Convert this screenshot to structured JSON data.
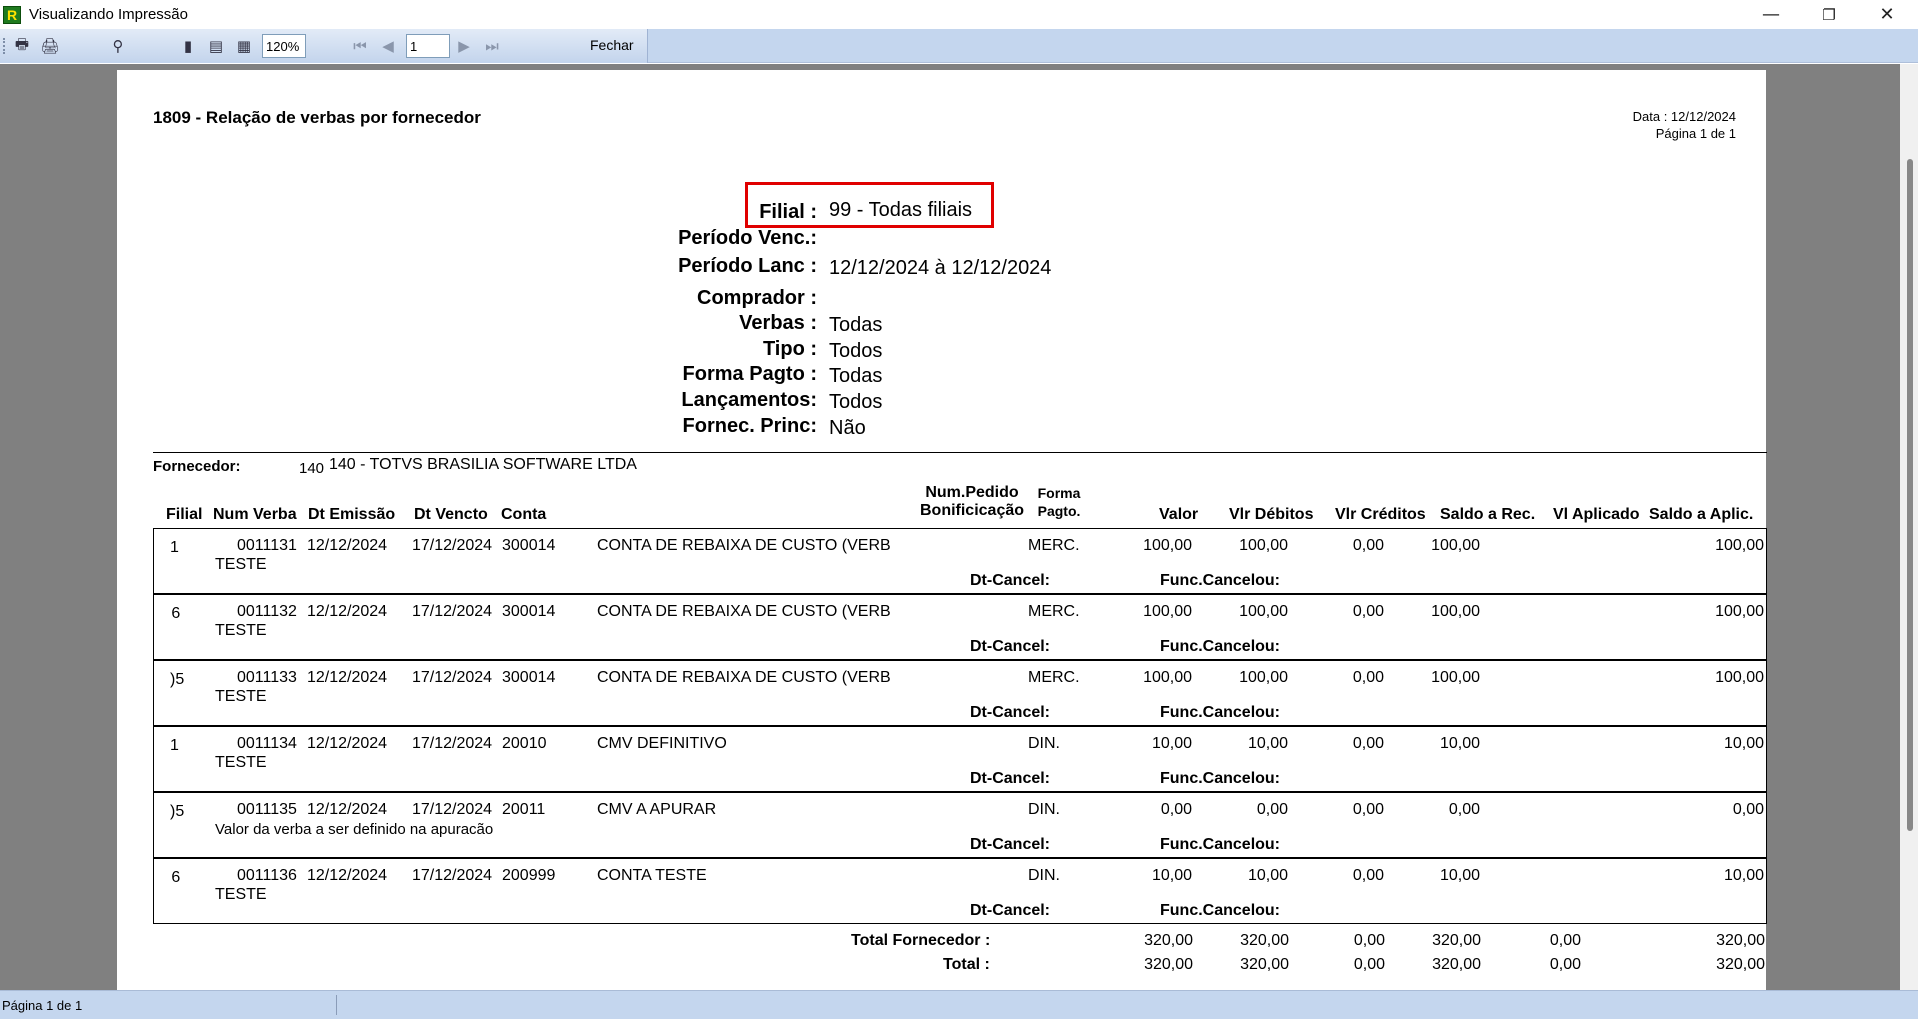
{
  "window": {
    "title": "Visualizando Impressão",
    "app_icon_letter": "R",
    "minimize": "—",
    "restore": "❐",
    "close": "✕"
  },
  "toolbar": {
    "zoom": "120%",
    "page_number": "1",
    "close_label": "Fechar"
  },
  "report": {
    "title": "1809 - Relação de verbas por fornecedor",
    "date": "Data : 12/12/2024",
    "page": "Página 1 de 1"
  },
  "params": [
    {
      "label": "Filial :",
      "value": "99 - Todas filiais"
    },
    {
      "label": "Período Venc.:",
      "value": ""
    },
    {
      "label": "Período Lanc :",
      "value": "12/12/2024 à 12/12/2024"
    },
    {
      "label": "Comprador :",
      "value": ""
    },
    {
      "label": "Verbas :",
      "value": "Todas"
    },
    {
      "label": "Tipo :",
      "value": "Todos"
    },
    {
      "label": "Forma Pagto :",
      "value": "Todas"
    },
    {
      "label": "Lançamentos:",
      "value": "Todos"
    },
    {
      "label": "Fornec. Princ:",
      "value": "Não"
    }
  ],
  "supplier": {
    "label": "Fornecedor:",
    "code": "140",
    "name": "140 - TOTVS BRASILIA SOFTWARE LTDA"
  },
  "columns": {
    "filial": "Filial",
    "num_verba": "Num Verba",
    "dt_emissao": "Dt Emissão",
    "dt_vencto": "Dt Vencto",
    "conta": "Conta",
    "num_pedido_1": "Num.Pedido",
    "num_pedido_2": "Bonificicação",
    "forma_1": "Forma",
    "forma_2": "Pagto.",
    "valor": "Valor",
    "vlr_debitos": "Vlr Débitos",
    "vlr_creditos": "Vlr Créditos",
    "saldo_rec": "Saldo a Rec.",
    "vl_aplicado": "Vl Aplicado",
    "saldo_aplic": "Saldo a Aplic."
  },
  "row_labels": {
    "dt_cancel": "Dt-Cancel:",
    "func_cancelou": "Func.Cancelou:"
  },
  "rows": [
    {
      "filial": "1",
      "num_verba": "0011131",
      "dt_emissao": "12/12/2024",
      "dt_vencto": "17/12/2024",
      "conta": "300014",
      "descricao": "CONTA DE REBAIXA DE CUSTO (VERB",
      "forma": "MERC.",
      "valor": "100,00",
      "debitos": "100,00",
      "creditos": "0,00",
      "saldo_rec": "100,00",
      "vl_aplicado": "",
      "saldo_aplic": "100,00",
      "obs": "TESTE"
    },
    {
      "filial": " 6",
      "num_verba": "0011132",
      "dt_emissao": "12/12/2024",
      "dt_vencto": "17/12/2024",
      "conta": "300014",
      "descricao": "CONTA DE REBAIXA DE CUSTO (VERB",
      "forma": "MERC.",
      "valor": "100,00",
      "debitos": "100,00",
      "creditos": "0,00",
      "saldo_rec": "100,00",
      "vl_aplicado": "",
      "saldo_aplic": "100,00",
      "obs": "TESTE"
    },
    {
      "filial": ")5",
      "num_verba": "0011133",
      "dt_emissao": "12/12/2024",
      "dt_vencto": "17/12/2024",
      "conta": "300014",
      "descricao": "CONTA DE REBAIXA DE CUSTO (VERB",
      "forma": "MERC.",
      "valor": "100,00",
      "debitos": "100,00",
      "creditos": "0,00",
      "saldo_rec": "100,00",
      "vl_aplicado": "",
      "saldo_aplic": "100,00",
      "obs": "TESTE"
    },
    {
      "filial": "1",
      "num_verba": "0011134",
      "dt_emissao": "12/12/2024",
      "dt_vencto": "17/12/2024",
      "conta": "20010",
      "descricao": "CMV DEFINITIVO",
      "forma": "DIN.",
      "valor": "10,00",
      "debitos": "10,00",
      "creditos": "0,00",
      "saldo_rec": "10,00",
      "vl_aplicado": "",
      "saldo_aplic": "10,00",
      "obs": "TESTE"
    },
    {
      "filial": ")5",
      "num_verba": "0011135",
      "dt_emissao": "12/12/2024",
      "dt_vencto": "17/12/2024",
      "conta": "20011",
      "descricao": "CMV A APURAR",
      "forma": "DIN.",
      "valor": "0,00",
      "debitos": "0,00",
      "creditos": "0,00",
      "saldo_rec": "0,00",
      "vl_aplicado": "",
      "saldo_aplic": "0,00",
      "obs": "Valor da verba a ser definido na apuracão"
    },
    {
      "filial": " 6",
      "num_verba": "0011136",
      "dt_emissao": "12/12/2024",
      "dt_vencto": "17/12/2024",
      "conta": "200999",
      "descricao": "CONTA TESTE",
      "forma": "DIN.",
      "valor": "10,00",
      "debitos": "10,00",
      "creditos": "0,00",
      "saldo_rec": "10,00",
      "vl_aplicado": "",
      "saldo_aplic": "10,00",
      "obs": "TESTE"
    }
  ],
  "totals": {
    "fornecedor": {
      "label": "Total Fornecedor :",
      "valor": "320,00",
      "debitos": "320,00",
      "creditos": "0,00",
      "saldo_rec": "320,00",
      "vl_aplicado": "0,00",
      "saldo_aplic": "320,00"
    },
    "geral": {
      "label": "Total :",
      "valor": "320,00",
      "debitos": "320,00",
      "creditos": "0,00",
      "saldo_rec": "320,00",
      "vl_aplicado": "0,00",
      "saldo_aplic": "320,00"
    }
  },
  "statusbar": {
    "text": "Página 1 de 1"
  }
}
